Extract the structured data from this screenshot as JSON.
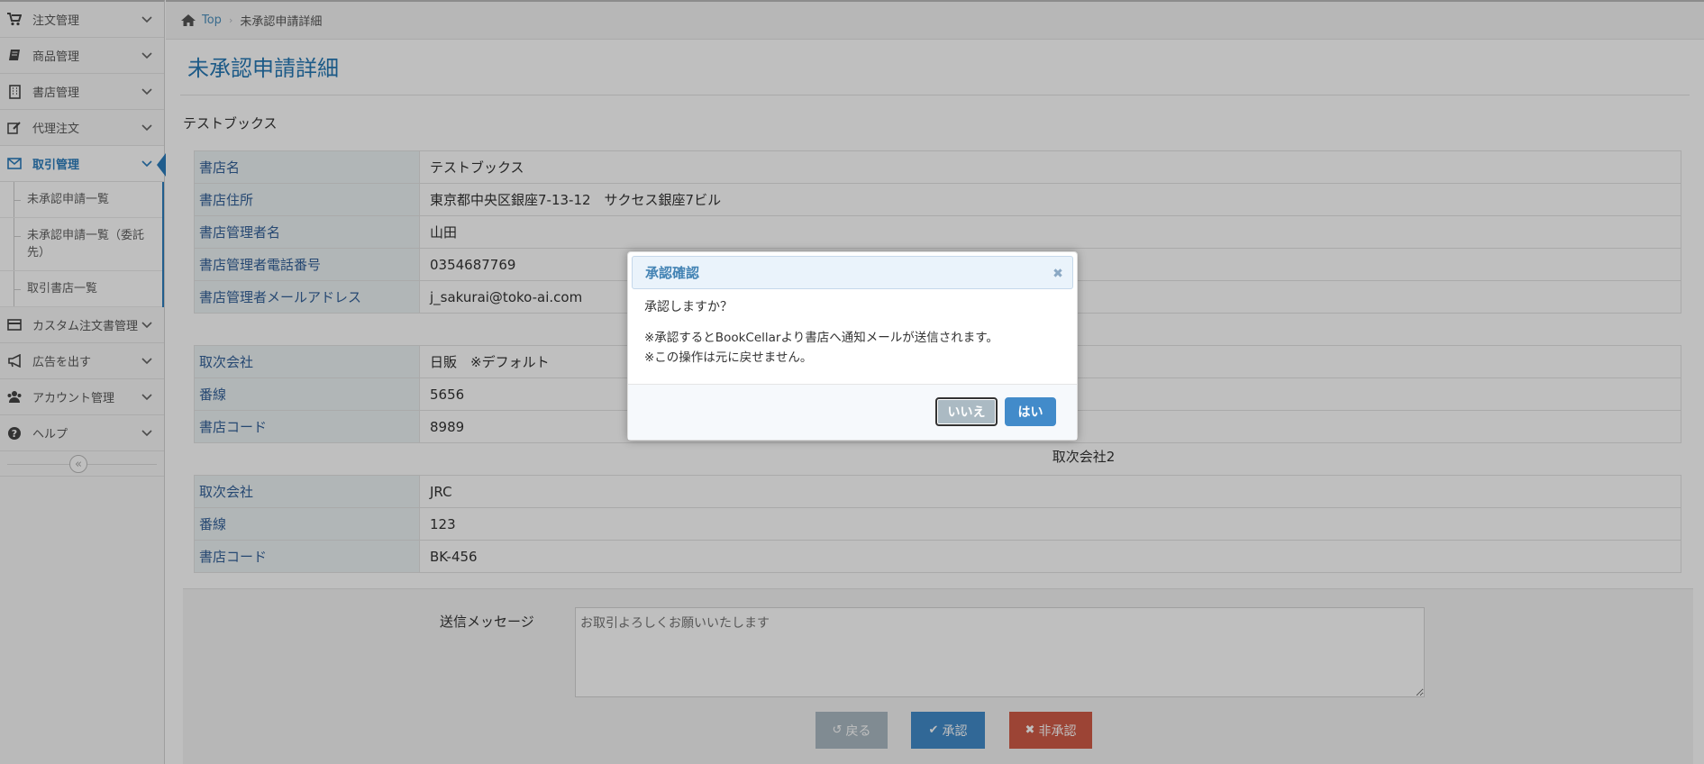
{
  "sidebar": {
    "items": [
      {
        "label": "注文管理",
        "icon": "cart-icon"
      },
      {
        "label": "商品管理",
        "icon": "book-icon"
      },
      {
        "label": "書店管理",
        "icon": "building-icon"
      },
      {
        "label": "代理注文",
        "icon": "edit-icon"
      },
      {
        "label": "取引管理",
        "icon": "envelope-icon"
      },
      {
        "label": "カスタム注文書管理",
        "icon": "card-icon"
      },
      {
        "label": "広告を出す",
        "icon": "bullhorn-icon"
      },
      {
        "label": "アカウント管理",
        "icon": "users-icon"
      },
      {
        "label": "ヘルプ",
        "icon": "question-icon"
      }
    ],
    "submenu": [
      "未承認申請一覧",
      "未承認申請一覧（委託先）",
      "取引書店一覧"
    ],
    "collapse_label": "«"
  },
  "breadcrumb": {
    "home": "Top",
    "current": "未承認申請詳細"
  },
  "page": {
    "title": "未承認申請詳細",
    "shop_name": "テストブックス"
  },
  "shop_table": [
    {
      "label": "書店名",
      "value": "テストブックス"
    },
    {
      "label": "書店住所",
      "value": "東京都中央区銀座7-13-12　サクセス銀座7ビル"
    },
    {
      "label": "書店管理者名",
      "value": "山田"
    },
    {
      "label": "書店管理者電話番号",
      "value": "0354687769"
    },
    {
      "label": "書店管理者メールアドレス",
      "value": "j_sakurai@toko-ai.com"
    }
  ],
  "distributor1": [
    {
      "label": "取次会社",
      "value": "日販　※デフォルト"
    },
    {
      "label": "番線",
      "value": "5656"
    },
    {
      "label": "書店コード",
      "value": "8989"
    }
  ],
  "distributor2_caption": "取次会社2",
  "distributor2": [
    {
      "label": "取次会社",
      "value": "JRC"
    },
    {
      "label": "番線",
      "value": "123"
    },
    {
      "label": "書店コード",
      "value": "BK-456"
    }
  ],
  "form": {
    "message_label": "送信メッセージ",
    "message_placeholder": "お取引よろしくお願いいたします",
    "back_label": "戻る",
    "approve_label": "承認",
    "reject_label": "非承認"
  },
  "dialog": {
    "title": "承認確認",
    "question": "承認しますか？",
    "note1": "※承認するとBookCellarより書店へ通知メールが送信されます。",
    "note2": "※この操作は元に戻せません。",
    "no_label": "いいえ",
    "yes_label": "はい"
  },
  "colors": {
    "accent": "#2b7dbc",
    "title": "#2679b5",
    "approve": "#428bca",
    "reject": "#d15b47",
    "back": "#abbac3"
  }
}
